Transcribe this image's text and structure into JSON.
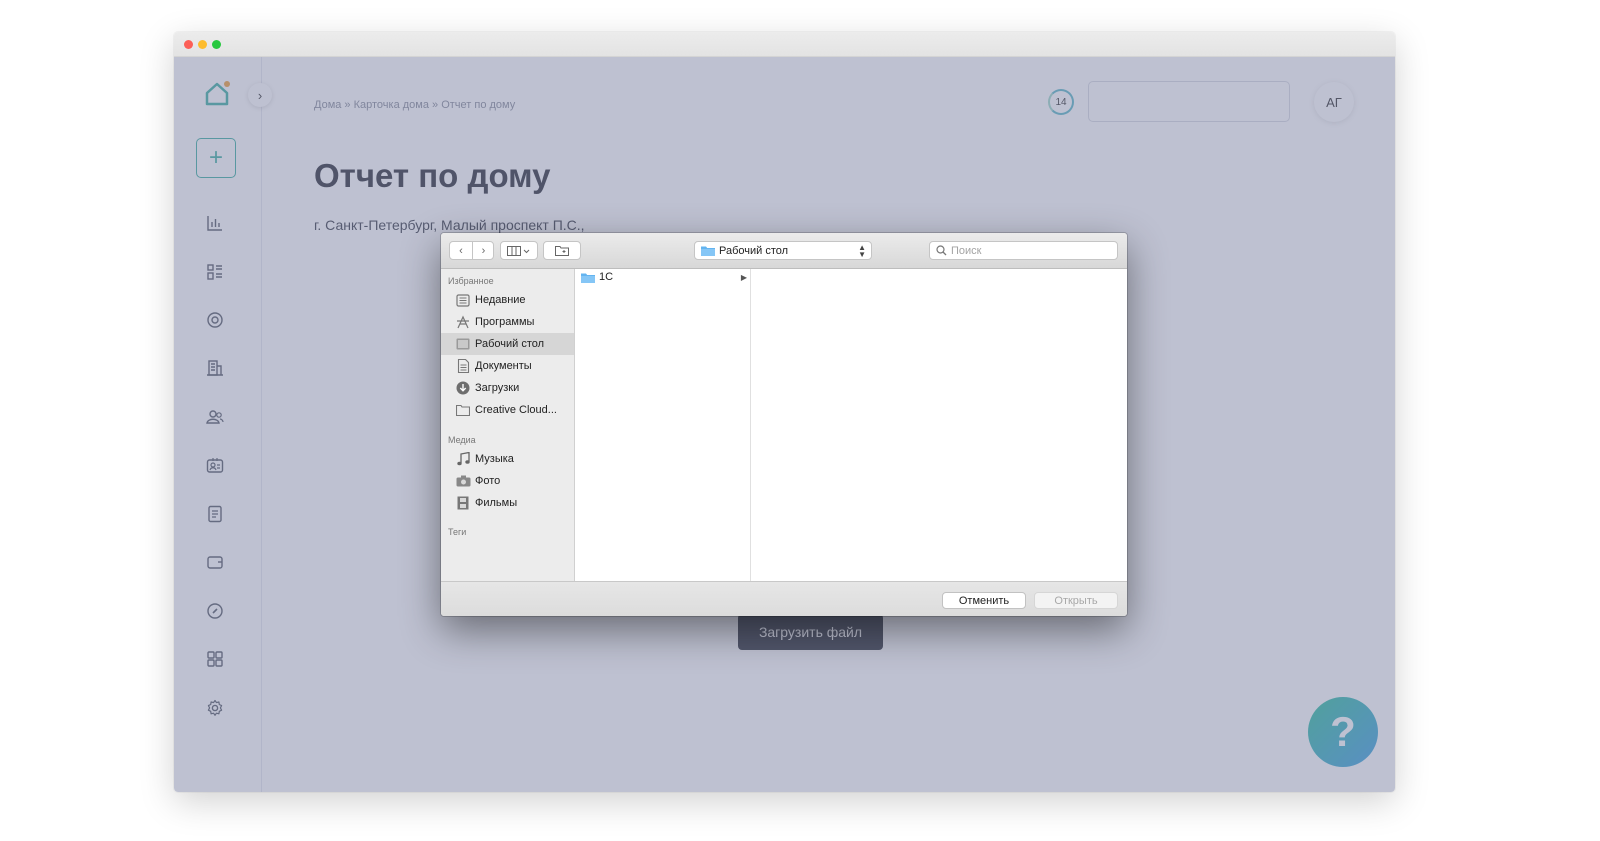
{
  "breadcrumb": "Дома » Карточка дома » Отчет по дому",
  "notification_count": "14",
  "header_search_value": "",
  "avatar_initials": "АГ",
  "page_title": "Отчет по дому",
  "address": "г. Санкт-Петербург, Малый проспект П.С.,",
  "upload_button": "Загрузить файл",
  "help_label": "?",
  "add_button": "+",
  "colors": {
    "accent": "#3fb0a3",
    "title": "#2c2f38",
    "overlay": "#787e9e"
  },
  "sidebar_icons": [
    "chart-icon",
    "dashboard-icon",
    "power-icon",
    "building-icon",
    "users-icon",
    "contact-card-icon",
    "document-icon",
    "wallet-icon",
    "compass-icon",
    "apps-icon",
    "settings-icon"
  ],
  "dialog": {
    "location": "Рабочий стол",
    "search_placeholder": "Поиск",
    "favorites_header": "Избранное",
    "favorites": [
      "Недавние",
      "Программы",
      "Рабочий стол",
      "Документы",
      "Загрузки",
      "Creative Cloud..."
    ],
    "media_header": "Медиа",
    "media": [
      "Музыка",
      "Фото",
      "Фильмы"
    ],
    "tags_header": "Теги",
    "files": [
      "1С"
    ],
    "cancel": "Отменить",
    "open": "Открыть"
  }
}
